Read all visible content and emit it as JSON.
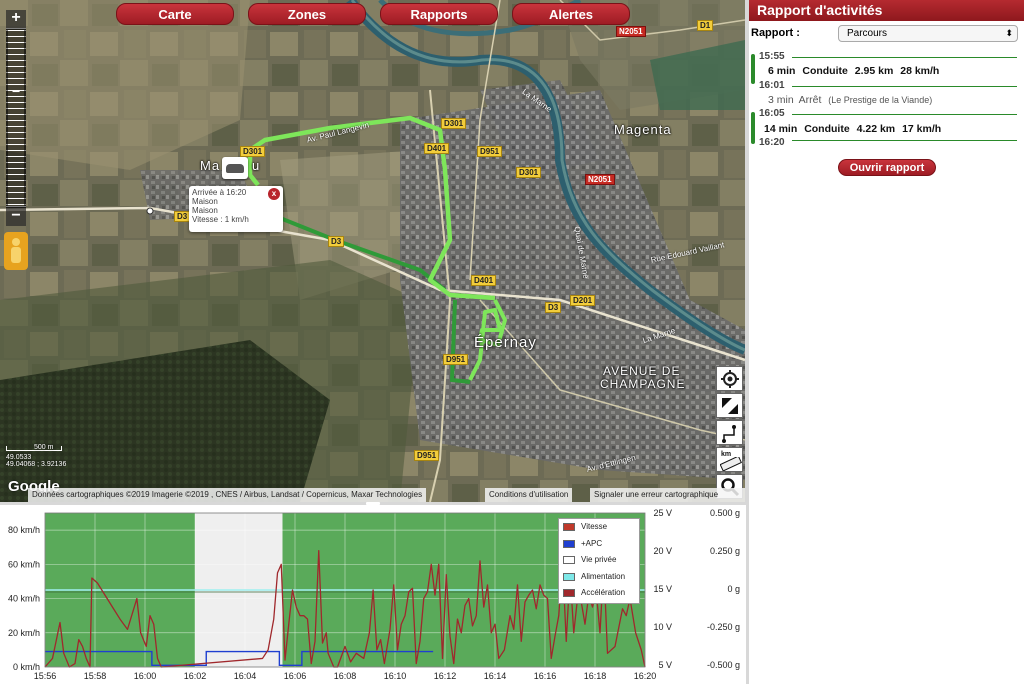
{
  "nav": {
    "tabs": [
      "Carte",
      "Zones",
      "Rapports",
      "Alertes"
    ],
    "accent": "#b2242c"
  },
  "map": {
    "places": {
      "magenta": "Magenta",
      "epernay": "Épernay",
      "avenue_line1": "AVENUE DE",
      "avenue_line2": "CHAMPAGNE",
      "ma": "Ma",
      "u": "u",
      "b": "B"
    },
    "roads": [
      "D301",
      "D401",
      "D951",
      "D301",
      "D301",
      "D3",
      "D3",
      "D401",
      "D3",
      "D201",
      "D951",
      "D951",
      "D1",
      "N2051",
      "N2051"
    ],
    "road_names": {
      "paul_langevin": "Av. Paul Langevin",
      "la_marne_1": "La Marne",
      "la_marne_2": "La Marne",
      "quai_marne": "Quai de Marne",
      "rue_vaillant": "Rue Edouard Vaillant",
      "av_etlingen": "Av. d'Ettlingen"
    },
    "popup": {
      "line1": "Arrivée à 16:20",
      "line2": "Maison",
      "line3": "Maison",
      "line4": "Vitesse : 1 km/h",
      "close": "x"
    },
    "scale": {
      "label": "500 m",
      "coord1": "49.0533",
      "coord2": "49.04068 ; 3.92136"
    },
    "google": "Google",
    "attribution": "Données cartographiques ©2019 Imagerie ©2019 , CNES / Airbus, Landsat / Copernicus, Maxar Technologies",
    "terms": "Conditions d'utilisation",
    "report_error": "Signaler une erreur cartographique",
    "tools": [
      "target-icon",
      "resize-icon",
      "route-icon",
      "ruler-icon",
      "search-icon"
    ],
    "ruler_label": "km",
    "zoom_in": "+",
    "zoom_out": "−",
    "zoom_mid": "−"
  },
  "panel": {
    "title": "Rapport d'activités",
    "report_label": "Rapport :",
    "report_value": "Parcours",
    "timeline": [
      {
        "time": "15:55"
      },
      {
        "duration": "6 min",
        "type": "Conduite",
        "distance": "2.95 km",
        "speed": "28 km/h"
      },
      {
        "time": "16:01"
      },
      {
        "duration": "3 min",
        "type": "Arrêt",
        "place": "(Le Prestige de la Viande)"
      },
      {
        "time": "16:05"
      },
      {
        "duration": "14 min",
        "type": "Conduite",
        "distance": "4.22 km",
        "speed": "17 km/h"
      },
      {
        "time": "16:20"
      }
    ],
    "open_button": "Ouvrir rapport"
  },
  "chart_data": {
    "type": "line",
    "x_ticks": [
      "15:56",
      "15:58",
      "16:00",
      "16:02",
      "16:04",
      "16:06",
      "16:08",
      "16:10",
      "16:12",
      "16:14",
      "16:16",
      "16:18",
      "16:20"
    ],
    "y_left_ticks": [
      "80 km/h",
      "60 km/h",
      "40 km/h",
      "20 km/h",
      "0 km/h"
    ],
    "y_mid_ticks": [
      "25 V",
      "20 V",
      "15 V",
      "10 V",
      "5 V"
    ],
    "y_right_ticks": [
      "0.500 g",
      "0.250 g",
      "0 g",
      "-0.250 g",
      "-0.500 g"
    ],
    "ylim_speed": [
      0,
      90
    ],
    "private_period": [
      "16:02",
      "16:05"
    ],
    "series": [
      {
        "name": "Vitesse",
        "color": "#c0392b"
      },
      {
        "name": "+APC",
        "color": "#1f3fd0"
      },
      {
        "name": "Vie privée",
        "color": "#ffffff"
      },
      {
        "name": "Alimentation",
        "color": "#7ee8e8"
      },
      {
        "name": "Accélération",
        "color": "#a0282c"
      }
    ],
    "speed_points": [
      [
        0,
        0
      ],
      [
        0.4,
        5
      ],
      [
        0.8,
        26
      ],
      [
        1.0,
        8
      ],
      [
        1.3,
        0
      ],
      [
        1.6,
        2
      ],
      [
        1.8,
        16
      ],
      [
        2.0,
        12
      ],
      [
        2.2,
        5
      ],
      [
        2.4,
        0
      ],
      [
        2.5,
        52
      ],
      [
        2.8,
        49
      ],
      [
        3.2,
        42
      ],
      [
        3.6,
        35
      ],
      [
        4.0,
        28
      ],
      [
        4.4,
        22
      ],
      [
        4.9,
        40
      ],
      [
        5.1,
        20
      ],
      [
        5.4,
        12
      ],
      [
        5.6,
        30
      ],
      [
        5.8,
        25
      ],
      [
        6.0,
        5
      ],
      [
        6.2,
        0
      ],
      [
        11.6,
        5
      ],
      [
        11.9,
        10
      ],
      [
        12.2,
        28
      ],
      [
        12.4,
        55
      ],
      [
        12.6,
        60
      ],
      [
        12.8,
        4
      ],
      [
        13.0,
        25
      ],
      [
        13.2,
        45
      ],
      [
        13.4,
        35
      ],
      [
        13.6,
        30
      ],
      [
        13.8,
        30
      ],
      [
        14.0,
        28
      ],
      [
        14.2,
        2
      ],
      [
        14.4,
        15
      ],
      [
        14.6,
        68
      ],
      [
        14.8,
        14
      ],
      [
        15.0,
        20
      ],
      [
        15.1,
        8
      ],
      [
        15.4,
        0
      ],
      [
        15.6,
        0
      ],
      [
        16.0,
        12
      ],
      [
        16.3,
        3
      ],
      [
        16.6,
        8
      ],
      [
        17.0,
        5
      ],
      [
        17.3,
        20
      ],
      [
        17.5,
        45
      ],
      [
        17.7,
        10
      ],
      [
        17.9,
        16
      ],
      [
        18.1,
        2
      ],
      [
        18.4,
        22
      ],
      [
        18.6,
        48
      ],
      [
        18.8,
        10
      ],
      [
        19.0,
        25
      ],
      [
        19.2,
        30
      ],
      [
        19.4,
        44
      ],
      [
        19.6,
        46
      ],
      [
        19.8,
        2
      ],
      [
        20.0,
        15
      ],
      [
        20.2,
        40
      ],
      [
        20.4,
        44
      ],
      [
        20.6,
        60
      ],
      [
        20.8,
        42
      ],
      [
        21.0,
        60
      ],
      [
        21.2,
        5
      ],
      [
        21.4,
        54
      ],
      [
        21.6,
        18
      ],
      [
        21.8,
        2
      ],
      [
        22.0,
        28
      ],
      [
        22.2,
        20
      ],
      [
        22.4,
        36
      ],
      [
        22.6,
        40
      ],
      [
        22.8,
        24
      ],
      [
        23.0,
        30
      ],
      [
        23.2,
        62
      ],
      [
        23.4,
        35
      ],
      [
        23.6,
        48
      ],
      [
        23.8,
        20
      ],
      [
        24.0,
        25
      ],
      [
        24.2,
        5
      ],
      [
        24.5,
        10
      ],
      [
        24.8,
        30
      ],
      [
        25.0,
        22
      ],
      [
        25.2,
        48
      ],
      [
        25.4,
        15
      ],
      [
        25.6,
        38
      ],
      [
        25.8,
        42
      ],
      [
        26.0,
        45
      ],
      [
        26.2,
        34
      ],
      [
        26.4,
        48
      ],
      [
        26.6,
        42
      ],
      [
        26.8,
        40
      ],
      [
        27.0,
        5
      ],
      [
        27.2,
        18
      ],
      [
        27.4,
        30
      ],
      [
        27.6,
        62
      ],
      [
        27.8,
        15
      ],
      [
        28.0,
        55
      ],
      [
        28.2,
        20
      ],
      [
        28.4,
        40
      ],
      [
        28.6,
        38
      ],
      [
        28.8,
        25
      ],
      [
        29.0,
        42
      ],
      [
        29.2,
        35
      ],
      [
        29.4,
        44
      ],
      [
        29.6,
        20
      ],
      [
        29.8,
        60
      ],
      [
        30.0,
        8
      ],
      [
        30.4,
        12
      ],
      [
        30.8,
        34
      ],
      [
        31.0,
        30
      ],
      [
        31.2,
        40
      ],
      [
        31.5,
        20
      ],
      [
        31.8,
        10
      ],
      [
        32.0,
        0
      ]
    ],
    "apc_points": [
      [
        0,
        9
      ],
      [
        5.7,
        9
      ],
      [
        5.7,
        1
      ],
      [
        8.6,
        1
      ],
      [
        8.6,
        9
      ],
      [
        12.5,
        9
      ],
      [
        12.5,
        1
      ],
      [
        13.7,
        1
      ],
      [
        13.7,
        9
      ],
      [
        20.7,
        9
      ]
    ],
    "x_range": [
      0,
      32
    ],
    "power_value": 45
  }
}
